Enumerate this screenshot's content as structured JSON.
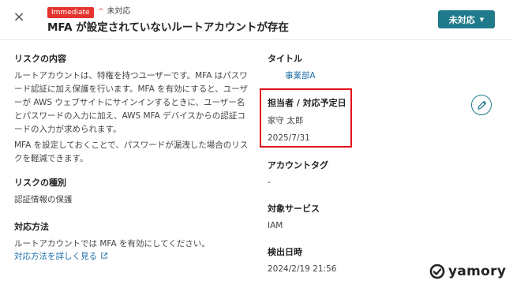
{
  "header": {
    "close_icon": "×",
    "priority_badge": "Immediate",
    "status_chevron": "^",
    "status_inline": "未対応",
    "title": "MFA が設定されていないルートアカウントが存在",
    "status_button": "未対応",
    "status_caret": "▼"
  },
  "left": {
    "risk_content": {
      "label": "リスクの内容",
      "lines": [
        "ルートアカウントは、特権を持つユーザーです。MFA はパスワ",
        "ード認証に加え保護を行います。MFA を有効にすると、ユーザ",
        "ーが AWS ウェブサイトにサインインするときに、ユーザー名",
        "とパスワードの入力に加え、AWS MFA デバイスからの認証コ",
        "ードの入力が求められます。"
      ],
      "lines2": [
        "MFA を設定しておくことで、パスワードが漏洩した場合のリス",
        "クを軽減できます。"
      ]
    },
    "risk_type": {
      "label": "リスクの種別",
      "value": "認証情報の保護"
    },
    "remedy": {
      "label": "対応方法",
      "text": "ルートアカウントでは MFA を有効にしてください。",
      "link": "対応方法を詳しく見る",
      "link_icon": "external-link-icon"
    }
  },
  "right": {
    "title_label": "タイトル",
    "title_value": "事業部A",
    "assignee_label": "担当者 / 対応予定日",
    "assignee_value": "家守 太郎",
    "due_value": "2025/7/31",
    "account_tag_label": "アカウントタグ",
    "account_tag_value": "-",
    "service_label": "対象サービス",
    "service_value": "IAM",
    "detected_label": "検出日時",
    "detected_value": "2024/2/19 21:56",
    "edit_icon": "pencil-icon"
  },
  "logo": {
    "text": "yamory"
  },
  "colors": {
    "accent": "#1f7a8c",
    "danger": "#e3342f",
    "highlight": "#e3101a",
    "link": "#1f6fa8"
  }
}
